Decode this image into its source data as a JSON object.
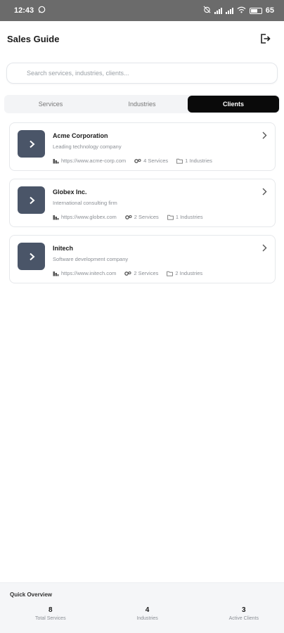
{
  "status_bar": {
    "time": "12:43",
    "battery": "65"
  },
  "header": {
    "title": "Sales Guide"
  },
  "search": {
    "placeholder": "Search services, industries, clients..."
  },
  "tabs": [
    {
      "label": "Services",
      "active": false
    },
    {
      "label": "Industries",
      "active": false
    },
    {
      "label": "Clients",
      "active": true
    }
  ],
  "clients": [
    {
      "name": "Acme Corporation",
      "description": "Leading technology company",
      "website": "https://www.acme-corp.com",
      "services": "4 Services",
      "industries": "1 Industries"
    },
    {
      "name": "Globex Inc.",
      "description": "International consulting firm",
      "website": "https://www.globex.com",
      "services": "2 Services",
      "industries": "1 Industries"
    },
    {
      "name": "Initech",
      "description": "Software development company",
      "website": "https://www.initech.com",
      "services": "2 Services",
      "industries": "2 Industries"
    }
  ],
  "overview": {
    "title": "Quick Overview",
    "stats": [
      {
        "value": "8",
        "label": "Total Services"
      },
      {
        "value": "4",
        "label": "Industries"
      },
      {
        "value": "3",
        "label": "Active Clients"
      }
    ]
  },
  "colors": {
    "accent": "#0a0a0a",
    "thumb": "#4a5568",
    "status_bar": "#6b6b6b"
  },
  "icons": {
    "logout": "logout-icon",
    "thumb": "chevron-right-icon",
    "website": "building-icon",
    "services": "gear-icon",
    "industries": "folder-icon",
    "card_chevron": "chevron-right-icon"
  }
}
